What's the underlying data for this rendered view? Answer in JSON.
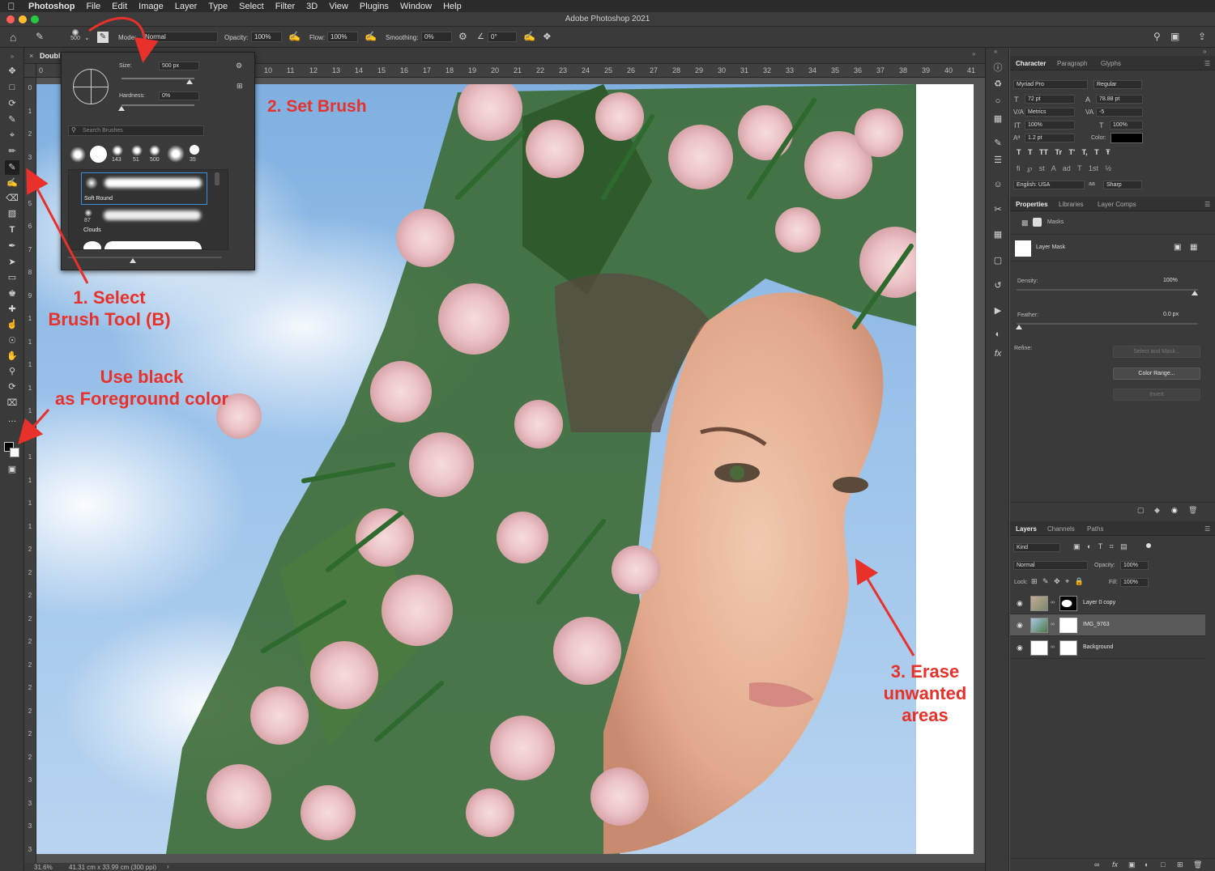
{
  "menubar": {
    "app": "Photoshop",
    "items": [
      "File",
      "Edit",
      "Image",
      "Layer",
      "Type",
      "Select",
      "Filter",
      "3D",
      "View",
      "Plugins",
      "Window",
      "Help"
    ]
  },
  "window": {
    "title": "Adobe Photoshop 2021",
    "doc_tab": "Doubl"
  },
  "options": {
    "brush_size": "500",
    "mode_label": "Mode:",
    "mode_value": "Normal",
    "opacity_label": "Opacity:",
    "opacity_value": "100%",
    "flow_label": "Flow:",
    "flow_value": "100%",
    "smoothing_label": "Smoothing:",
    "smoothing_value": "0%",
    "angle_value": "0°"
  },
  "brush_popup": {
    "size_label": "Size:",
    "size_value": "500 px",
    "hardness_label": "Hardness:",
    "hardness_value": "0%",
    "search_placeholder": "Search Brushes",
    "tip_sizes": [
      "143",
      "51",
      "500",
      "35"
    ],
    "presets": [
      {
        "name": "Soft Round"
      },
      {
        "name": "Clouds",
        "size": "87"
      }
    ]
  },
  "ruler_top": [
    "0",
    "10",
    "11",
    "12",
    "13",
    "14",
    "15",
    "16",
    "17",
    "18",
    "19",
    "20",
    "21",
    "22",
    "23",
    "24",
    "25",
    "26",
    "27",
    "28",
    "29",
    "30",
    "31",
    "32",
    "33",
    "34",
    "35",
    "36",
    "37",
    "38",
    "39",
    "40",
    "41"
  ],
  "ruler_left": [
    "0",
    "1",
    "2",
    "3",
    "4",
    "5",
    "6",
    "7",
    "8",
    "9",
    "1",
    "1",
    "1",
    "1",
    "1",
    "1",
    "1",
    "1",
    "1",
    "1",
    "2",
    "2",
    "2",
    "2",
    "2",
    "2",
    "2",
    "2",
    "2",
    "2",
    "3",
    "3",
    "3",
    "3"
  ],
  "status": {
    "zoom": "31.6%",
    "dimensions": "41.31 cm x 33.99 cm (300 ppi)"
  },
  "character": {
    "tabs": [
      "Character",
      "Paragraph",
      "Glyphs"
    ],
    "font_family": "Myriad Pro",
    "font_style": "Regular",
    "size": "72 pt",
    "leading": "78.88 pt",
    "kerning": "Metrics",
    "tracking": "-5",
    "vscale": "100%",
    "hscale": "100%",
    "baseline": "1.2 pt",
    "color_label": "Color:",
    "color": "#000000",
    "language": "English: USA",
    "antialias": "Sharp"
  },
  "properties": {
    "tabs": [
      "Properties",
      "Libraries",
      "Layer Comps"
    ],
    "section": "Masks",
    "mask_type": "Layer Mask",
    "density_label": "Density:",
    "density_value": "100%",
    "feather_label": "Feather:",
    "feather_value": "0.0 px",
    "refine_label": "Refine:",
    "select_mask_btn": "Select and Mask...",
    "color_range_btn": "Color Range...",
    "invert_btn": "Invert"
  },
  "layers": {
    "tabs": [
      "Layers",
      "Channels",
      "Paths"
    ],
    "filter": "Kind",
    "blend": "Normal",
    "opacity_label": "Opacity:",
    "opacity_value": "100%",
    "lock_label": "Lock:",
    "fill_label": "Fill:",
    "fill_value": "100%",
    "items": [
      {
        "name": "Layer 0 copy"
      },
      {
        "name": "IMG_9763"
      },
      {
        "name": "Background"
      }
    ]
  },
  "annotations": {
    "step1_line1": "1. Select",
    "step1_line2": "Brush Tool (B)",
    "step2": "2. Set Brush",
    "fg_line1": "Use black",
    "fg_line2": "as Foreground color",
    "step3_line1": "3. Erase",
    "step3_line2": "unwanted",
    "step3_line3": "areas",
    "color": "#e8312b"
  }
}
